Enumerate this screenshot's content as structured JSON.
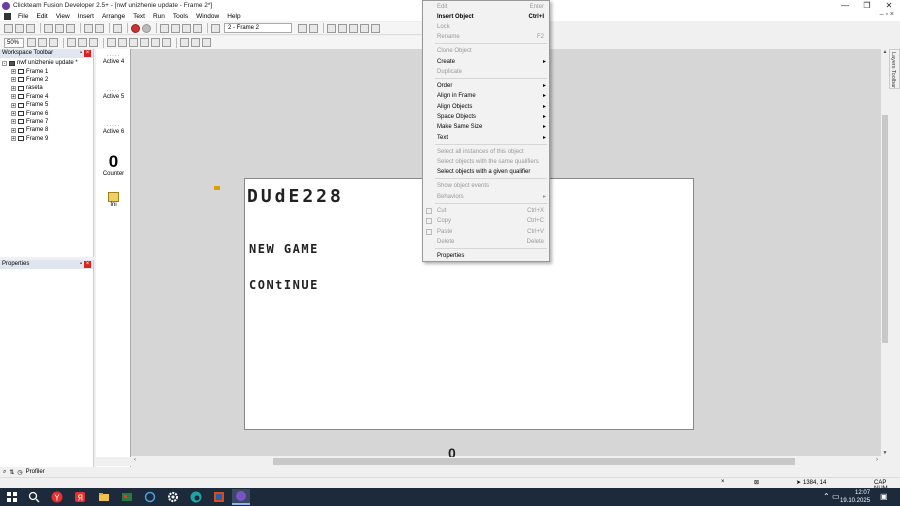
{
  "window": {
    "title": "Clickteam Fusion Developer 2.5+ - [nwf unizhenie update - Frame 2*]",
    "controls": [
      "—",
      "❐",
      "✕"
    ]
  },
  "menu": {
    "items": [
      "File",
      "Edit",
      "View",
      "Insert",
      "Arrange",
      "Text",
      "Run",
      "Tools",
      "Window",
      "Help"
    ],
    "right_controls": "– ▫ ×"
  },
  "toolbar": {
    "frame_select": "2 - Frame 2",
    "zoom_select": "50%"
  },
  "workspace": {
    "header": "Workspace Toolbar",
    "tree": [
      {
        "label": "nwf unizhenie update *"
      },
      {
        "label": "Frame 1"
      },
      {
        "label": "Frame 2"
      },
      {
        "label": "raseta"
      },
      {
        "label": "Frame 4"
      },
      {
        "label": "Frame 5"
      },
      {
        "label": "Frame 6"
      },
      {
        "label": "Frame 7"
      },
      {
        "label": "Frame 8"
      },
      {
        "label": "Frame 9"
      }
    ]
  },
  "properties": {
    "header": "Properties",
    "bottom_label": "Profiler"
  },
  "objects": [
    {
      "preview": "·····",
      "label": "Active 4"
    },
    {
      "preview": "·····",
      "label": "Active 5"
    },
    {
      "preview": "·····",
      "label": "Active 6"
    },
    {
      "preview": "0",
      "label": "Counter"
    },
    {
      "preview": "ini",
      "label": "Ini"
    }
  ],
  "frame": {
    "title_text": "DUdE228",
    "menu_items": [
      "NEW GAME",
      "CONtINUE"
    ],
    "offscreen_counter": "0"
  },
  "layers_tab": "Layers Toolbar",
  "context_menu": {
    "items": [
      {
        "label": "Edit",
        "shortcut": "Enter",
        "disabled": true
      },
      {
        "label": "Insert Object",
        "shortcut": "Ctrl+I",
        "bold": true
      },
      {
        "label": "Lock",
        "disabled": true
      },
      {
        "label": "Rename",
        "shortcut": "F2",
        "disabled": true
      },
      {
        "label": "Clone Object",
        "disabled": true
      },
      {
        "label": "Create",
        "submenu": true
      },
      {
        "label": "Duplicate",
        "disabled": true
      },
      {
        "label": "Order",
        "submenu": true
      },
      {
        "label": "Align in Frame",
        "submenu": true
      },
      {
        "label": "Align Objects",
        "submenu": true
      },
      {
        "label": "Space Objects",
        "submenu": true
      },
      {
        "label": "Make Same Size",
        "submenu": true
      },
      {
        "label": "Text",
        "submenu": true
      },
      {
        "label": "Select all instances of this object",
        "disabled": true
      },
      {
        "label": "Select objects with the same qualifiers",
        "disabled": true
      },
      {
        "label": "Select objects with a given qualifier"
      },
      {
        "label": "Show object events",
        "disabled": true
      },
      {
        "label": "Behaviors",
        "submenu": true,
        "disabled": true
      },
      {
        "label": "Cut",
        "shortcut": "Ctrl+X",
        "disabled": true
      },
      {
        "label": "Copy",
        "shortcut": "Ctrl+C",
        "disabled": true
      },
      {
        "label": "Paste",
        "shortcut": "Ctrl+V",
        "disabled": true
      },
      {
        "label": "Delete",
        "shortcut": "Delete",
        "disabled": true
      },
      {
        "label": "Properties"
      }
    ]
  },
  "statusbar": {
    "coords": "1384, 14",
    "caps": "CAP NUM"
  },
  "taskbar": {
    "time": "12:07",
    "date": "19.10.2025"
  },
  "colors": {
    "taskbar": "#1c2a3c",
    "editor_bg": "#d6d6d6",
    "close_red": "#dd2222"
  }
}
